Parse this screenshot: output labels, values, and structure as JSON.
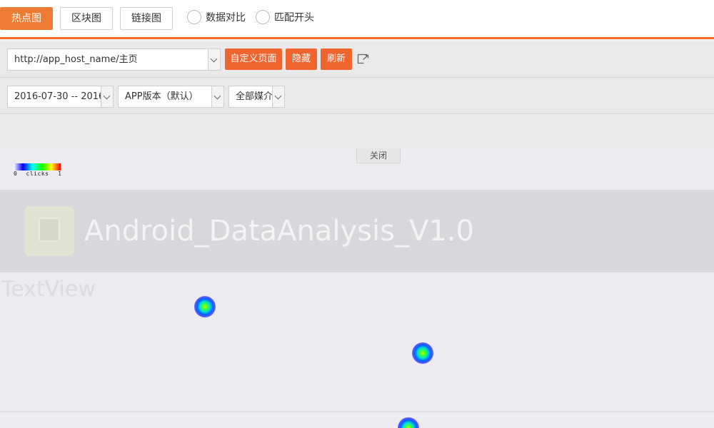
{
  "tabs": [
    {
      "label": "热点图",
      "active": true
    },
    {
      "label": "区块图",
      "active": false
    },
    {
      "label": "链接图",
      "active": false
    }
  ],
  "options": [
    {
      "label": "数据对比",
      "checked": false
    },
    {
      "label": "匹配开头",
      "checked": false
    }
  ],
  "filters": {
    "page_select": "http://app_host_name/主页",
    "custom_page_button": "自定义页面",
    "hide_button": "隐藏",
    "refresh_button": "刷新",
    "external_icon": "external-link-icon",
    "date_range": "2016-07-30 -- 2016-",
    "app_version": "APP版本（默认）",
    "media": "全部媒介"
  },
  "heatmap": {
    "close_label": "关闭",
    "legend": {
      "min": "0",
      "label": "clicks",
      "max": "1"
    },
    "app_title": "Android_DataAnalysis_V1.0",
    "textview_label": "TextView",
    "hotspot_count": 3
  },
  "colors": {
    "accent": "#ee7b33",
    "button_orange": "#f0642d",
    "panel_bg": "#e9e9e9",
    "heat_bg": "#ecebef"
  }
}
